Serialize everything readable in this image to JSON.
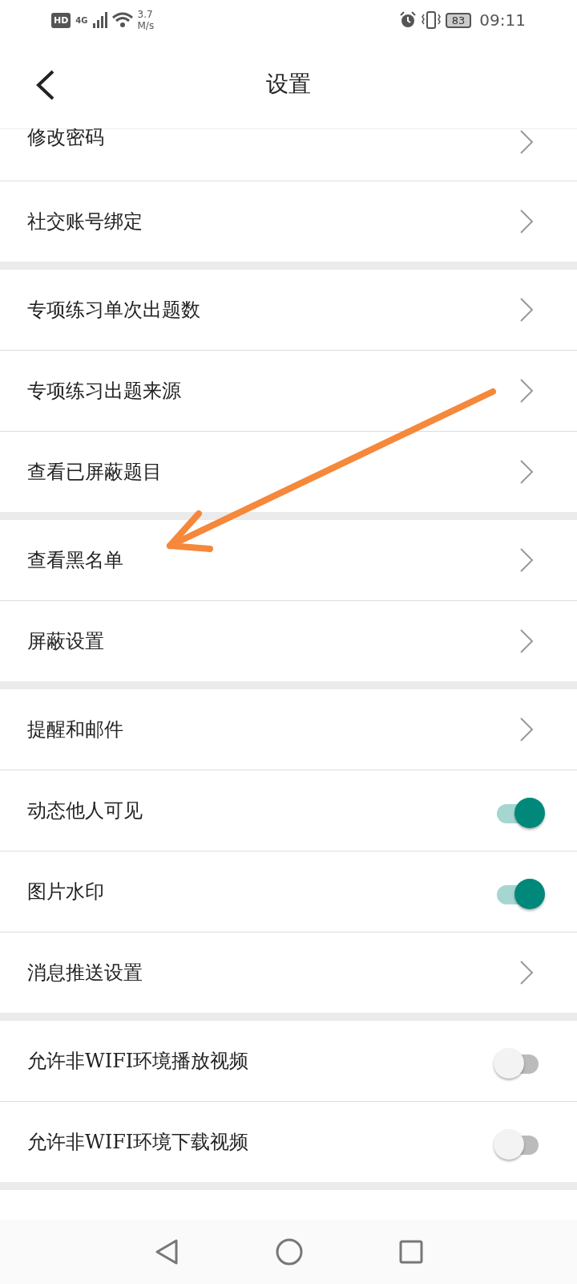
{
  "status_bar": {
    "hd": "HD",
    "network": "4G",
    "speed": "3.7",
    "speed_unit": "M/s",
    "battery": "83",
    "time": "09:11"
  },
  "header": {
    "title": "设置"
  },
  "sections": [
    {
      "rows": [
        {
          "label": "修改密码",
          "kind": "link"
        },
        {
          "label": "社交账号绑定",
          "kind": "link"
        }
      ]
    },
    {
      "rows": [
        {
          "label": "专项练习单次出题数",
          "kind": "link"
        },
        {
          "label": "专项练习出题来源",
          "kind": "link"
        },
        {
          "label": "查看已屏蔽题目",
          "kind": "link"
        }
      ]
    },
    {
      "rows": [
        {
          "label": "查看黑名单",
          "kind": "link"
        },
        {
          "label": "屏蔽设置",
          "kind": "link"
        }
      ]
    },
    {
      "rows": [
        {
          "label": "提醒和邮件",
          "kind": "link"
        },
        {
          "label": "动态他人可见",
          "kind": "toggle",
          "on": true
        },
        {
          "label": "图片水印",
          "kind": "toggle",
          "on": true
        },
        {
          "label": "消息推送设置",
          "kind": "link"
        }
      ]
    },
    {
      "rows": [
        {
          "label": "允许非WIFI环境播放视频",
          "kind": "toggle",
          "on": false
        },
        {
          "label": "允许非WIFI环境下载视频",
          "kind": "toggle",
          "on": false
        }
      ]
    }
  ]
}
